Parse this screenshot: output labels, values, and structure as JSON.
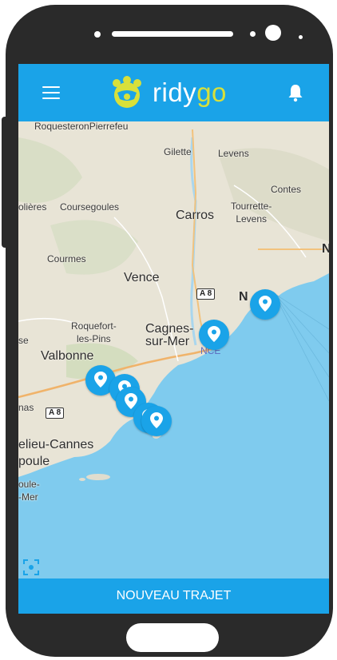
{
  "app": {
    "name_main": "ridy",
    "name_accent": "go",
    "brand_color": "#1aa3e8",
    "accent_color": "#d8e03a"
  },
  "appbar": {
    "menu_icon": "hamburger-menu-icon",
    "notifications_icon": "bell-icon"
  },
  "map": {
    "places": [
      {
        "id": "roquesteron",
        "label": "RoquesteronPierrefeu"
      },
      {
        "id": "gilette",
        "label": "Gilette"
      },
      {
        "id": "levens",
        "label": "Levens"
      },
      {
        "id": "contes",
        "label": "Contes"
      },
      {
        "id": "tourrette",
        "label": "Tourrette-\nLevens"
      },
      {
        "id": "olieres",
        "label": "olières"
      },
      {
        "id": "coursegoules",
        "label": "Coursegoules"
      },
      {
        "id": "carros",
        "label": "Carros"
      },
      {
        "id": "courmes",
        "label": "Courmes"
      },
      {
        "id": "vence",
        "label": "Vence"
      },
      {
        "id": "roquefort",
        "label": "Roquefort-\nles-Pins"
      },
      {
        "id": "cagnes",
        "label": "Cagnes-\nsur-Mer"
      },
      {
        "id": "valbonne",
        "label": "Valbonne"
      },
      {
        "id": "se",
        "label": "se"
      },
      {
        "id": "nas",
        "label": "nas"
      },
      {
        "id": "mandelieu",
        "label": "elieu-Cannes"
      },
      {
        "id": "napoule",
        "label": "poule"
      },
      {
        "id": "theoule",
        "label": "oule-\n-Mer"
      },
      {
        "id": "nice",
        "label": "N"
      },
      {
        "id": "edge_n",
        "label": "N"
      }
    ],
    "roads": [
      "A 8",
      "A 8"
    ],
    "airport_code": "NCE",
    "pins": [
      "location-pin",
      "location-pin",
      "location-pin",
      "location-pin",
      "location-pin",
      "location-pin",
      "location-pin"
    ]
  },
  "bottom": {
    "new_trip_label": "NOUVEAU TRAJET"
  }
}
